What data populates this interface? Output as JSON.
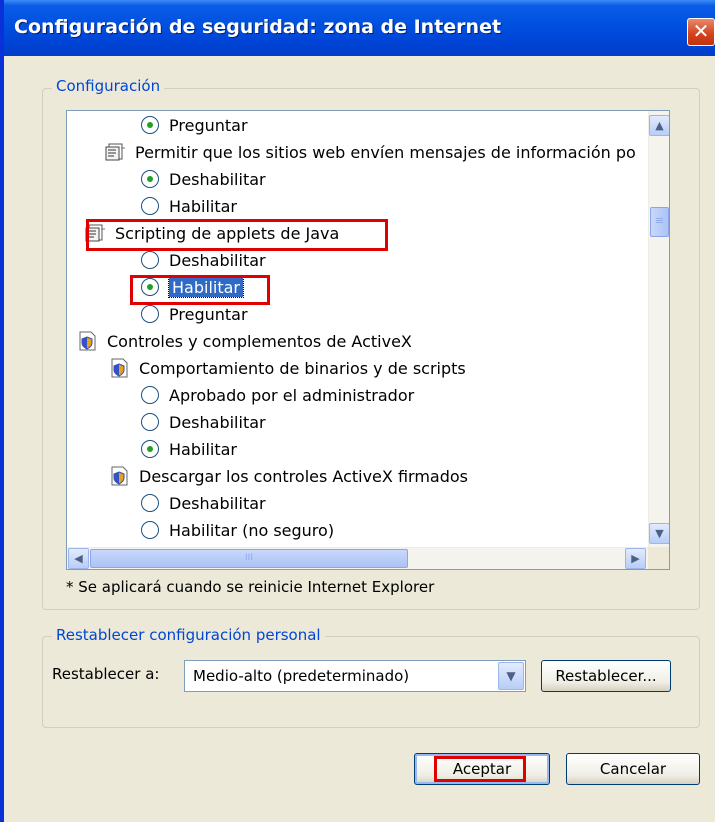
{
  "window": {
    "title": "Configuración de seguridad: zona de Internet",
    "close_glyph": "✕"
  },
  "settings_group": {
    "legend": "Configuración",
    "rows": [
      {
        "kind": "radio",
        "label": "Preguntar",
        "checked": true
      },
      {
        "kind": "category",
        "icon": "script-settings-icon",
        "label": "Permitir que los sitios web envíen mensajes de información po"
      },
      {
        "kind": "radio",
        "label": "Deshabilitar",
        "checked": true
      },
      {
        "kind": "radio",
        "label": "Habilitar",
        "checked": false
      },
      {
        "kind": "category",
        "icon": "script-settings-icon",
        "label": "Scripting de applets de Java"
      },
      {
        "kind": "radio",
        "label": "Deshabilitar",
        "checked": false
      },
      {
        "kind": "radio",
        "label": "Habilitar",
        "checked": true,
        "selected": true
      },
      {
        "kind": "radio",
        "label": "Preguntar",
        "checked": false
      },
      {
        "kind": "category",
        "icon": "activex-settings-icon",
        "label": "Controles y complementos de ActiveX"
      },
      {
        "kind": "category",
        "icon": "activex-settings-icon",
        "label": "Comportamiento de binarios y de scripts"
      },
      {
        "kind": "radio",
        "label": "Aprobado por el administrador",
        "checked": false
      },
      {
        "kind": "radio",
        "label": "Deshabilitar",
        "checked": false
      },
      {
        "kind": "radio",
        "label": "Habilitar",
        "checked": true
      },
      {
        "kind": "category",
        "icon": "activex-settings-icon",
        "label": "Descargar los controles ActiveX firmados"
      },
      {
        "kind": "radio",
        "label": "Deshabilitar",
        "checked": false
      },
      {
        "kind": "radio",
        "label": "Habilitar (no seguro)",
        "checked": false
      }
    ],
    "scroll": {
      "up": "▲",
      "down": "▼",
      "left": "◀",
      "right": "▶",
      "grip_h": "III",
      "grip_v": "≡"
    },
    "note": "* Se aplicará cuando se reinicie Internet Explorer"
  },
  "reset_group": {
    "legend": "Restablecer configuración personal",
    "label": "Restablecer a:",
    "selected_value": "Medio-alto (predeterminado)",
    "dropdown_arrow": "▼",
    "reset_button": "Restablecer..."
  },
  "footer": {
    "ok_button": "Aceptar",
    "cancel_button": "Cancelar"
  },
  "colors": {
    "highlight_box": "#e00000",
    "selection": "#316ac5",
    "titlebar": "#0050e0"
  }
}
